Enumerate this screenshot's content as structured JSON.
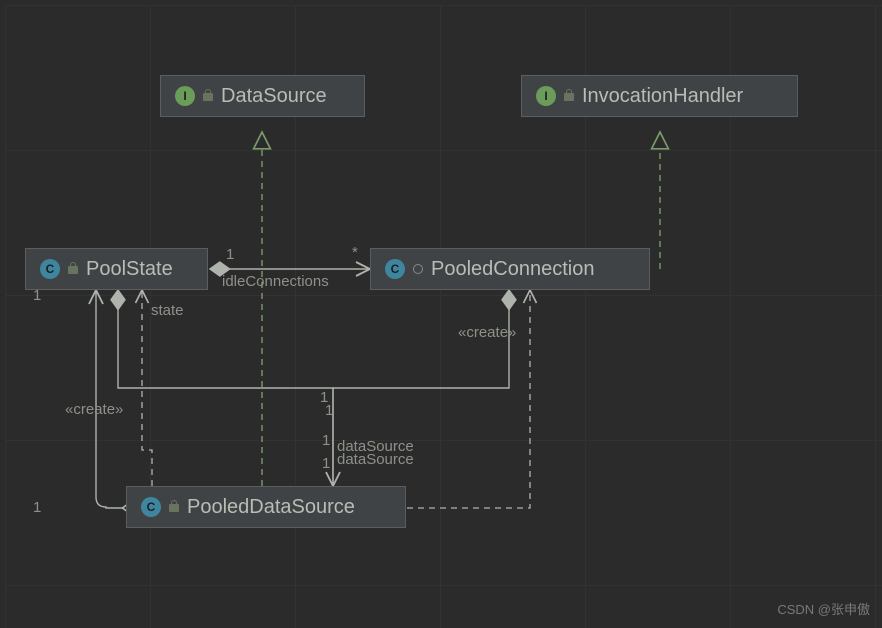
{
  "nodes": {
    "dataSource": {
      "name": "DataSource",
      "badge": "I"
    },
    "invocationHandler": {
      "name": "InvocationHandler",
      "badge": "I"
    },
    "poolState": {
      "name": "PoolState",
      "badge": "C"
    },
    "pooledConnection": {
      "name": "PooledConnection",
      "badge": "C"
    },
    "pooledDataSource": {
      "name": "PooledDataSource",
      "badge": "C"
    }
  },
  "labels": {
    "idleConnections": "idleConnections",
    "state": "state",
    "createLeft": "«create»",
    "createRight": "«create»",
    "dataSource1": "dataSource",
    "dataSource2": "dataSource",
    "one_a": "1",
    "one_b": "1",
    "one_c": "1",
    "star": "*",
    "one_d": "1",
    "one_e": "1",
    "one_f": "1",
    "one_g": "1"
  },
  "watermark": "CSDN @张申傲"
}
